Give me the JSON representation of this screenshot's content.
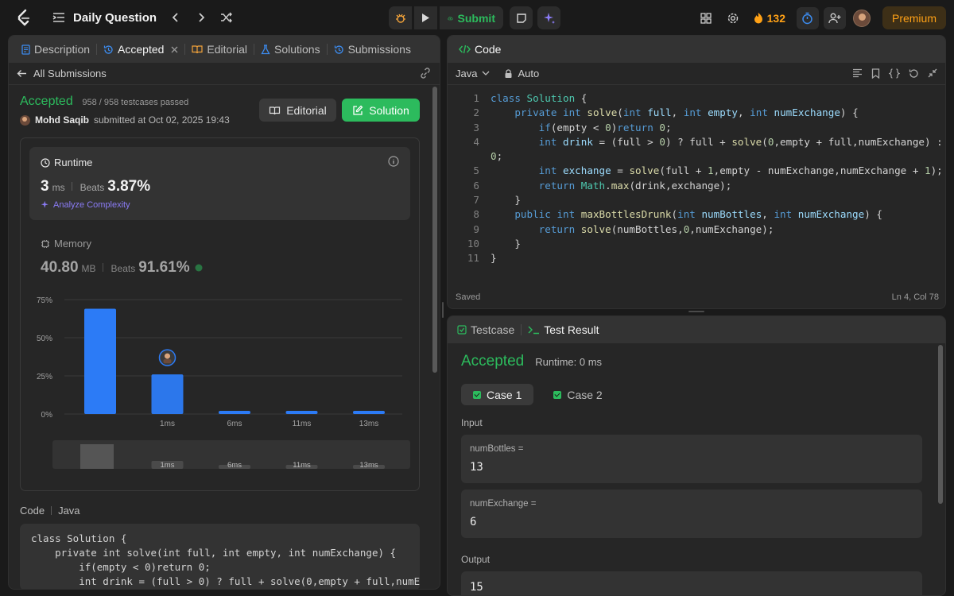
{
  "topbar": {
    "title": "Daily Question",
    "submit_label": "Submit",
    "streak": "132",
    "premium_label": "Premium"
  },
  "left_tabs": [
    {
      "label": "Description"
    },
    {
      "label": "Accepted"
    },
    {
      "label": "Editorial"
    },
    {
      "label": "Solutions"
    },
    {
      "label": "Submissions"
    }
  ],
  "submission": {
    "back_label": "All Submissions",
    "status": "Accepted",
    "testcases": "958 / 958 testcases passed",
    "user": "Mohd Saqib",
    "submitted_at": "submitted at Oct 02, 2025 19:43",
    "editorial_label": "Editorial",
    "solution_label": "Solution"
  },
  "runtime": {
    "label": "Runtime",
    "value": "3",
    "unit": "ms",
    "beats_label": "Beats",
    "beats_value": "3.87%",
    "analyze_label": "Analyze Complexity"
  },
  "memory": {
    "label": "Memory",
    "value": "40.80",
    "unit": "MB",
    "beats_label": "Beats",
    "beats_value": "91.61%"
  },
  "chart_data": {
    "type": "bar",
    "categories": [
      "",
      "1ms",
      "6ms",
      "11ms",
      "13ms"
    ],
    "values": [
      69,
      26,
      1.5,
      1.5,
      1.5
    ],
    "highlight_index": 1,
    "yticks": [
      "0%",
      "25%",
      "50%",
      "75%"
    ],
    "ylim": [
      0,
      75
    ],
    "grid": true,
    "mini_labels": [
      "1ms",
      "6ms",
      "11ms",
      "13ms"
    ],
    "colors": {
      "bar": "#2c7bf6",
      "grid": "#3a3a3a"
    }
  },
  "code_section": {
    "label": "Code",
    "lang": "Java",
    "snippet": "class Solution {\n    private int solve(int full, int empty, int numExchange) {\n        if(empty < 0)return 0;\n        int drink = (full > 0) ? full + solve(0,empty + full,numEx"
  },
  "editor": {
    "tab_label": "Code",
    "language": "Java",
    "mode": "Auto",
    "status_left": "Saved",
    "status_right": "Ln 4, Col 78",
    "line_numbers": [
      "1",
      "2",
      "3",
      "4",
      "",
      "5",
      "6",
      "7",
      "8",
      "9",
      "10",
      "11"
    ]
  },
  "test": {
    "tab_testcase": "Testcase",
    "tab_result": "Test Result",
    "status": "Accepted",
    "runtime": "Runtime: 0 ms",
    "cases": [
      "Case 1",
      "Case 2"
    ],
    "input_label": "Input",
    "inputs": [
      {
        "name": "numBottles =",
        "value": "13"
      },
      {
        "name": "numExchange =",
        "value": "6"
      }
    ],
    "output_label": "Output",
    "output_value": "15"
  }
}
